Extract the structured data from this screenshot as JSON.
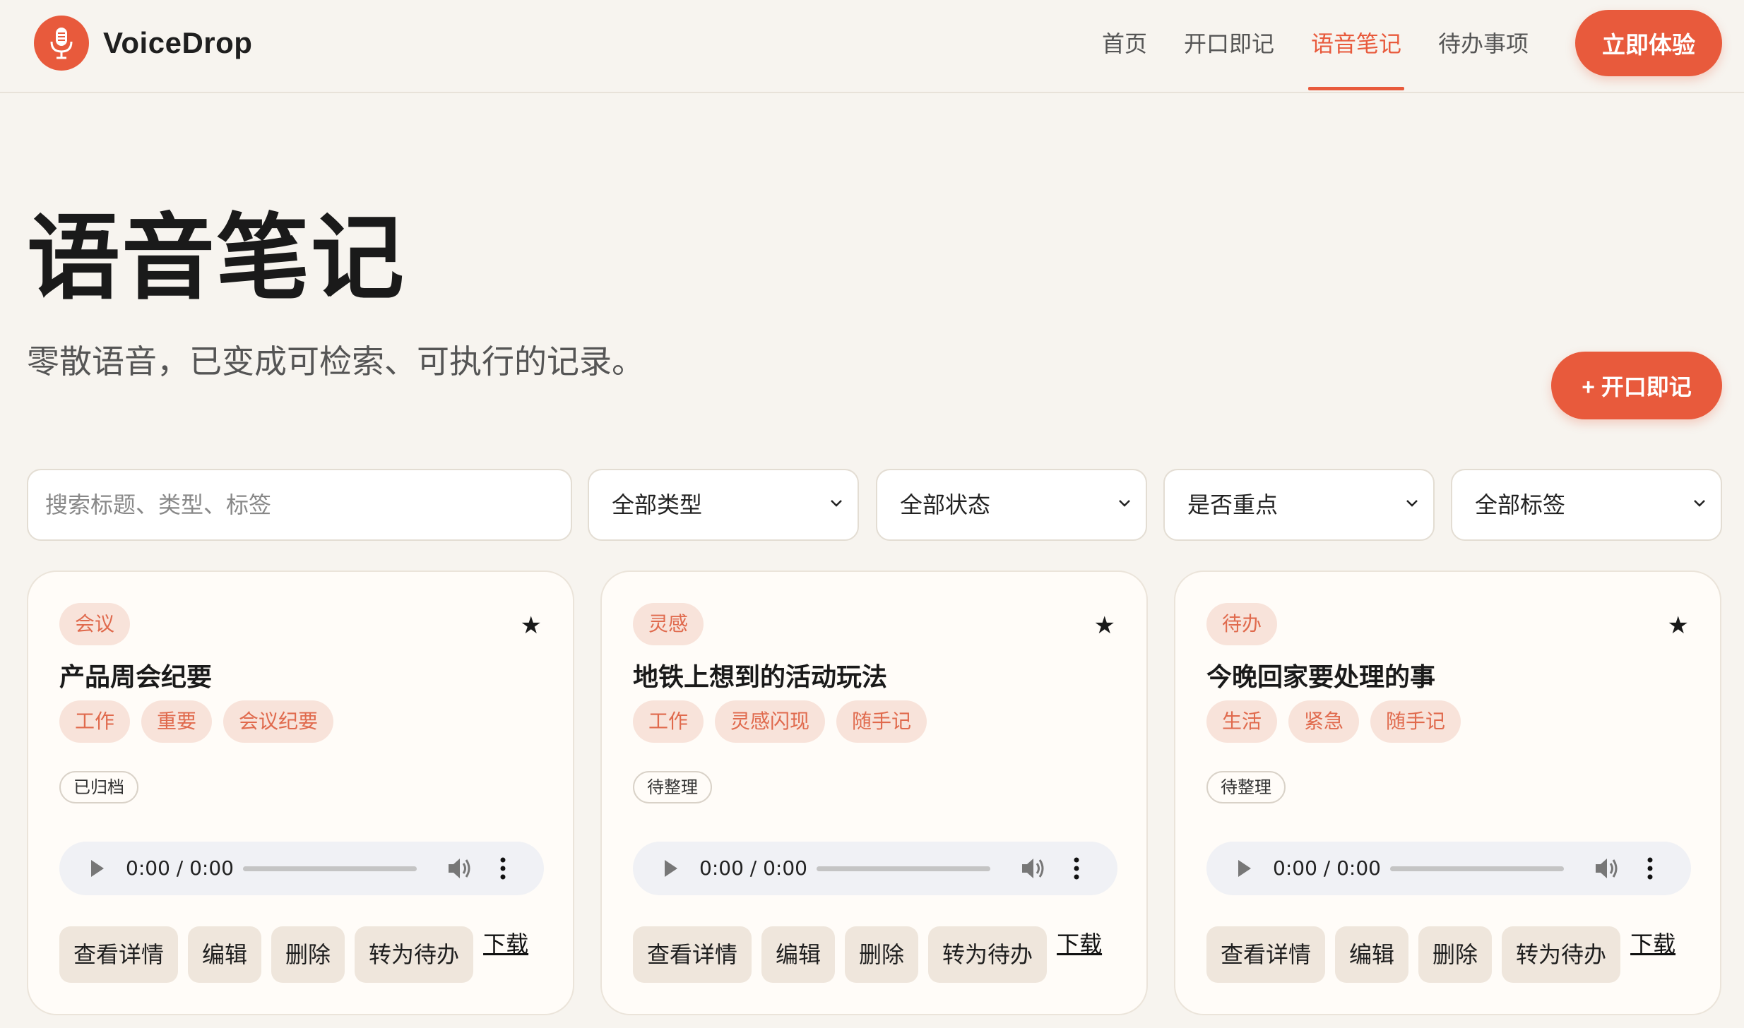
{
  "brand": {
    "name": "VoiceDrop",
    "icon": "microphone-icon",
    "accent": "#e85a3c"
  },
  "nav": {
    "items": [
      {
        "label": "首页",
        "active": false
      },
      {
        "label": "开口即记",
        "active": false
      },
      {
        "label": "语音笔记",
        "active": true
      },
      {
        "label": "待办事项",
        "active": false
      }
    ],
    "cta": "立即体验"
  },
  "hero": {
    "title": "语音笔记",
    "subtitle": "零散语音，已变成可检索、可执行的记录。",
    "record_button": "+ 开口即记"
  },
  "filters": {
    "search_placeholder": "搜索标题、类型、标签",
    "type": "全部类型",
    "status": "全部状态",
    "important": "是否重点",
    "tag": "全部标签"
  },
  "cards": [
    {
      "type": "会议",
      "title": "产品周会纪要",
      "tags": [
        "工作",
        "重要",
        "会议纪要"
      ],
      "status": "已归档",
      "audio_time": "0:00 / 0:00",
      "actions": {
        "detail": "查看详情",
        "edit": "编辑",
        "delete": "删除",
        "todo": "转为待办",
        "download": "下载"
      }
    },
    {
      "type": "灵感",
      "title": "地铁上想到的活动玩法",
      "tags": [
        "工作",
        "灵感闪现",
        "随手记"
      ],
      "status": "待整理",
      "audio_time": "0:00 / 0:00",
      "actions": {
        "detail": "查看详情",
        "edit": "编辑",
        "delete": "删除",
        "todo": "转为待办",
        "download": "下载"
      }
    },
    {
      "type": "待办",
      "title": "今晚回家要处理的事",
      "tags": [
        "生活",
        "紧急",
        "随手记"
      ],
      "status": "待整理",
      "audio_time": "0:00 / 0:00",
      "actions": {
        "detail": "查看详情",
        "edit": "编辑",
        "delete": "删除",
        "todo": "转为待办",
        "download": "下载"
      }
    }
  ]
}
